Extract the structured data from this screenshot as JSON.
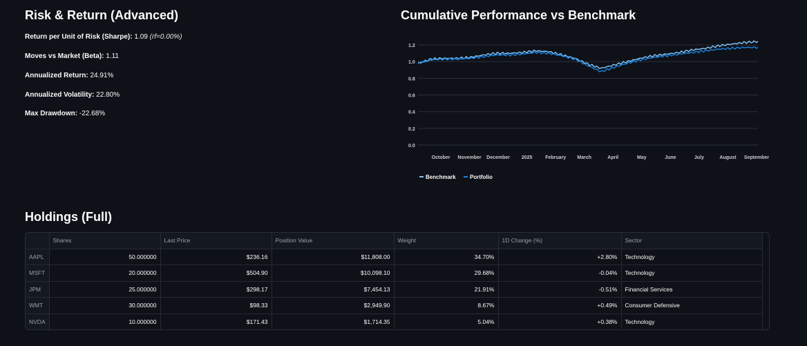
{
  "risk": {
    "title": "Risk & Return (Advanced)",
    "sharpe_label": "Return per Unit of Risk (Sharpe):",
    "sharpe_value": "1.09",
    "sharpe_note": "(rf=0.00%)",
    "beta_label": "Moves vs Market (Beta):",
    "beta_value": "1.11",
    "ann_return_label": "Annualized Return:",
    "ann_return_value": "24.91%",
    "ann_vol_label": "Annualized Volatility:",
    "ann_vol_value": "22.80%",
    "max_dd_label": "Max Drawdown:",
    "max_dd_value": "-22.68%"
  },
  "performance": {
    "title": "Cumulative Performance vs Benchmark"
  },
  "chart_data": {
    "type": "line",
    "title": "Cumulative Performance vs Benchmark",
    "xlabel": "",
    "ylabel": "",
    "ylim": [
      0,
      1.3
    ],
    "yticks": [
      "1.2",
      "1.0",
      "0.8",
      "0.6",
      "0.4",
      "0.2",
      "0.0"
    ],
    "yticks_values": [
      1.2,
      1.0,
      0.8,
      0.6,
      0.4,
      0.2,
      0.0
    ],
    "xticks": [
      "October",
      "November",
      "December",
      "2025",
      "February",
      "March",
      "April",
      "May",
      "June",
      "July",
      "August",
      "September"
    ],
    "grid": true,
    "legend_placement": "bottom-left",
    "x": [
      "Sep",
      "Oct",
      "Oct",
      "Nov",
      "Nov",
      "Dec",
      "Dec",
      "Jan",
      "Jan",
      "Feb",
      "Feb",
      "Mar",
      "Mar",
      "Apr-a",
      "Apr-b",
      "Apr-c",
      "Apr-d",
      "May",
      "May",
      "Jun",
      "Jun",
      "Jul",
      "Jul",
      "Aug",
      "Aug",
      "Sep",
      "Sep"
    ],
    "series": [
      {
        "name": "Benchmark",
        "color": "#83c9ff",
        "values": [
          0.98,
          1.03,
          1.04,
          1.04,
          1.05,
          1.08,
          1.1,
          1.1,
          1.11,
          1.13,
          1.12,
          1.08,
          1.04,
          0.97,
          0.92,
          0.96,
          1.0,
          1.04,
          1.07,
          1.09,
          1.11,
          1.14,
          1.16,
          1.19,
          1.21,
          1.23,
          1.24
        ]
      },
      {
        "name": "Portfolio",
        "color": "#1c83e1",
        "values": [
          0.98,
          1.02,
          1.03,
          1.03,
          1.04,
          1.06,
          1.08,
          1.08,
          1.09,
          1.11,
          1.1,
          1.07,
          1.03,
          0.95,
          0.88,
          0.93,
          0.98,
          1.02,
          1.05,
          1.07,
          1.09,
          1.11,
          1.13,
          1.15,
          1.16,
          1.17,
          1.17
        ]
      }
    ]
  },
  "holdings": {
    "title": "Holdings (Full)",
    "columns": [
      "",
      "Shares",
      "Last Price",
      "Position Value",
      "Weight",
      "1D Change (%)",
      "Sector"
    ],
    "rows": [
      [
        "AAPL",
        "50.000000",
        "$236.16",
        "$11,808.00",
        "34.70%",
        "+2.80%",
        "Technology"
      ],
      [
        "MSFT",
        "20.000000",
        "$504.90",
        "$10,098.10",
        "29.68%",
        "-0.04%",
        "Technology"
      ],
      [
        "JPM",
        "25.000000",
        "$298.17",
        "$7,454.13",
        "21.91%",
        "-0.51%",
        "Financial Services"
      ],
      [
        "WMT",
        "30.000000",
        "$98.33",
        "$2,949.90",
        "8.67%",
        "+0.49%",
        "Consumer Defensive"
      ],
      [
        "NVDA",
        "10.000000",
        "$171.43",
        "$1,714.35",
        "5.04%",
        "+0.38%",
        "Technology"
      ]
    ]
  }
}
